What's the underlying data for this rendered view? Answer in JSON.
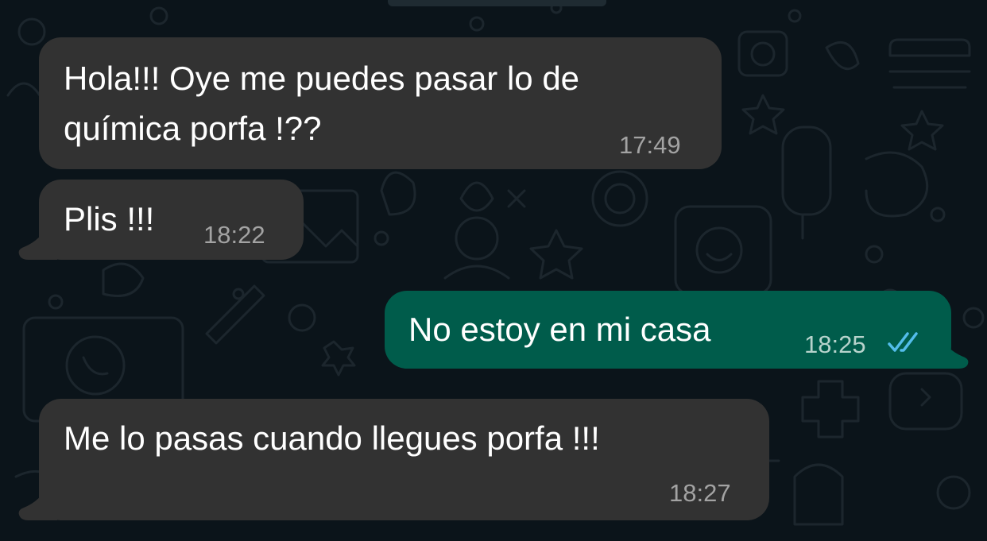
{
  "theme": {
    "background": "#0b141a",
    "incoming_bubble": "#323232",
    "outgoing_bubble": "#005c4b",
    "read_tick_color": "#53bdeb"
  },
  "messages": [
    {
      "direction": "incoming",
      "lines": [
        "Hola!!! Oye me puedes pasar lo de",
        "química porfa !??"
      ],
      "time": "17:49"
    },
    {
      "direction": "incoming",
      "lines": [
        "Plis !!!"
      ],
      "time": "18:22"
    },
    {
      "direction": "outgoing",
      "lines": [
        "No estoy en mi casa"
      ],
      "time": "18:25",
      "status_icon": "double-check-read-icon"
    },
    {
      "direction": "incoming",
      "lines": [
        "Me lo pasas cuando llegues porfa !!!"
      ],
      "time": "18:27"
    }
  ]
}
